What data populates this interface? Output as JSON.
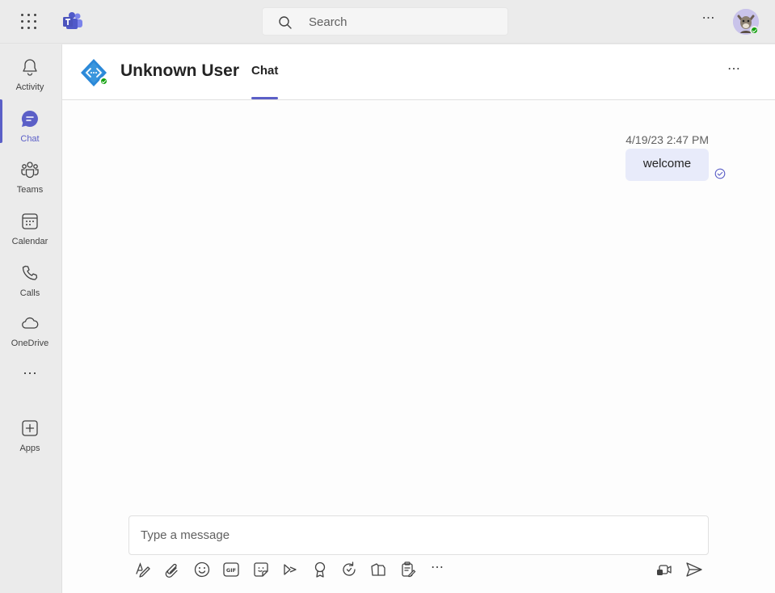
{
  "titlebar": {
    "search_label": "Search"
  },
  "rail": {
    "items": [
      {
        "label": "Activity",
        "icon": "bell-icon"
      },
      {
        "label": "Chat",
        "icon": "chat-icon"
      },
      {
        "label": "Teams",
        "icon": "teams-icon"
      },
      {
        "label": "Calendar",
        "icon": "calendar-icon"
      },
      {
        "label": "Calls",
        "icon": "phone-icon"
      },
      {
        "label": "OneDrive",
        "icon": "cloud-icon"
      },
      {
        "label": "Apps",
        "icon": "apps-add-icon"
      }
    ],
    "active": "Chat"
  },
  "chat": {
    "title": "Unknown User",
    "tab_label": "Chat",
    "messages": [
      {
        "timestamp": "4/19/23 2:47 PM",
        "text": "welcome",
        "status": "sent"
      }
    ],
    "compose_placeholder": "Type a message"
  },
  "colors": {
    "accent": "#5b5fc7",
    "presence": "#13a10e",
    "bubble": "#e8ebfa"
  }
}
